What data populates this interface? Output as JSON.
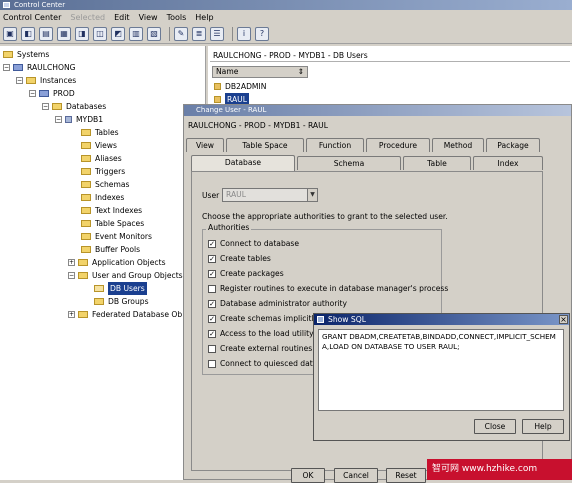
{
  "window": {
    "title": "Control Center"
  },
  "menu": [
    "Control Center",
    "Selected",
    "Edit",
    "View",
    "Tools",
    "Help"
  ],
  "toolbar_icons": [
    "systems-icon",
    "instances-icon",
    "databases-icon",
    "tables-icon",
    "views-icon",
    "aliases-icon",
    "triggers-icon",
    "schemas-icon",
    "indexes-icon",
    "new-icon",
    "details-icon",
    "list-icon",
    "info-icon",
    "help-icon"
  ],
  "tree": {
    "nodes": [
      {
        "label": "Systems"
      },
      {
        "label": "RAULCHONG"
      },
      {
        "label": "Instances"
      },
      {
        "label": "PROD"
      },
      {
        "label": "Databases"
      },
      {
        "label": "MYDB1"
      },
      {
        "label": "Tables"
      },
      {
        "label": "Views"
      },
      {
        "label": "Aliases"
      },
      {
        "label": "Triggers"
      },
      {
        "label": "Schemas"
      },
      {
        "label": "Indexes"
      },
      {
        "label": "Text Indexes"
      },
      {
        "label": "Table Spaces"
      },
      {
        "label": "Event Monitors"
      },
      {
        "label": "Buffer Pools"
      },
      {
        "label": "Application Objects"
      },
      {
        "label": "User and Group Objects"
      },
      {
        "label": "DB Users"
      },
      {
        "label": "DB Groups"
      },
      {
        "label": "Federated Database Ob"
      }
    ]
  },
  "content": {
    "header": "RAULCHONG - PROD - MYDB1 - DB Users",
    "column": "Name",
    "sort_glyph": "⇕",
    "rows": [
      "DB2ADMIN",
      "RAUL"
    ]
  },
  "dialog": {
    "title": "Change User - RAUL",
    "path": "RAULCHONG - PROD - MYDB1 - RAUL",
    "tabs_row1": [
      "View",
      "Table Space",
      "Function",
      "Procedure",
      "Method",
      "Package"
    ],
    "tabs_row2": [
      "Database",
      "Schema",
      "Table",
      "Index"
    ],
    "user_label": "User",
    "user_value": "RAUL",
    "instruction": "Choose the appropriate authorities to grant to the selected user.",
    "group_title": "Authorities",
    "authorities": [
      {
        "label": "Connect to database",
        "checked": true
      },
      {
        "label": "Create tables",
        "checked": true
      },
      {
        "label": "Create packages",
        "checked": true
      },
      {
        "label": "Register routines to execute in database manager's process",
        "checked": false
      },
      {
        "label": "Database administrator authority",
        "checked": true
      },
      {
        "label": "Create schemas implicitly",
        "checked": true
      },
      {
        "label": "Access to the load utility",
        "checked": true
      },
      {
        "label": "Create external routines",
        "checked": false
      },
      {
        "label": "Connect to quiesced datal",
        "checked": false
      }
    ],
    "buttons": [
      "OK",
      "Cancel",
      "Reset"
    ]
  },
  "sql": {
    "title": "Show SQL",
    "text": "GRANT DBADM,CREATETAB,BINDADD,CONNECT,IMPLICIT_SCHEMA,LOAD ON DATABASE  TO USER RAUL;",
    "close": "Close",
    "help": "Help",
    "close_glyph": "×"
  },
  "watermark": "智可网 www.hzhike.com"
}
